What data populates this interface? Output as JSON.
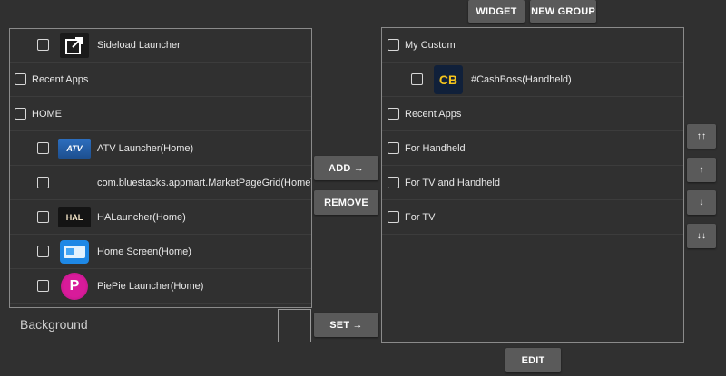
{
  "top_buttons": {
    "widget": "WIDGET",
    "new_group": "NEW GROUP"
  },
  "left_list": [
    {
      "label": "Sideload Launcher",
      "indent": true,
      "icon": "sideload-icon"
    },
    {
      "label": "Recent Apps",
      "indent": false,
      "icon": null
    },
    {
      "label": "HOME",
      "indent": false,
      "icon": null
    },
    {
      "label": "ATV Launcher(Home)",
      "indent": true,
      "icon": "atv-icon",
      "icon_text": "ATV"
    },
    {
      "label": "com.bluestacks.appmart.MarketPageGrid(Home)",
      "indent": true,
      "icon": null
    },
    {
      "label": "HALauncher(Home)",
      "indent": true,
      "icon": "hal-icon",
      "icon_text": "HAL"
    },
    {
      "label": "Home Screen(Home)",
      "indent": true,
      "icon": "home-screen-icon"
    },
    {
      "label": "PiePie Launcher(Home)",
      "indent": true,
      "icon": "piepie-icon",
      "icon_text": "P"
    }
  ],
  "middle_buttons": {
    "add": "ADD →",
    "remove": "REMOVE",
    "set": "SET →"
  },
  "right_list": [
    {
      "label": "My Custom",
      "indent": false,
      "icon": null
    },
    {
      "label": "#CashBoss(Handheld)",
      "indent": true,
      "icon": "cashboss-icon",
      "icon_text": "CB"
    },
    {
      "label": "Recent Apps",
      "indent": false,
      "icon": null
    },
    {
      "label": "For Handheld",
      "indent": false,
      "icon": null
    },
    {
      "label": "For TV and Handheld",
      "indent": false,
      "icon": null
    },
    {
      "label": "For TV",
      "indent": false,
      "icon": null
    }
  ],
  "order_buttons": {
    "top": "↑↑",
    "up": "↑",
    "down": "↓",
    "bottom": "↓↓"
  },
  "background": {
    "label": "Background"
  },
  "edit_button": "EDIT"
}
